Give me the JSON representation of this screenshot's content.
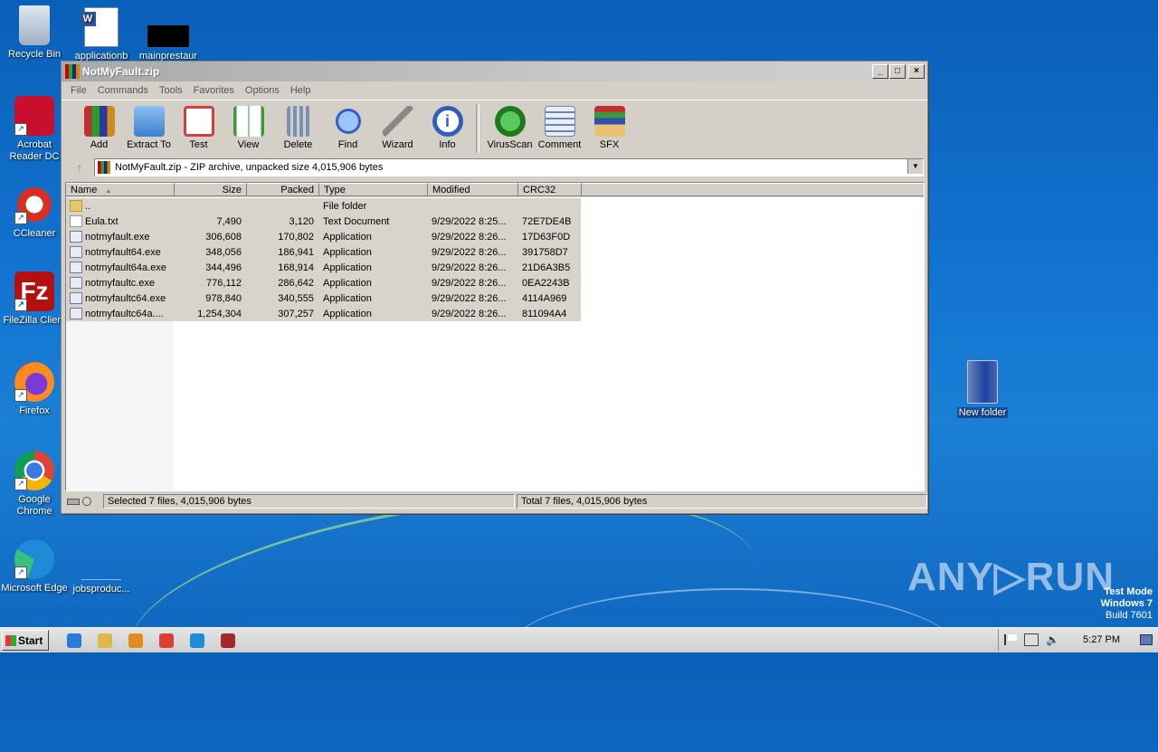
{
  "desktop": {
    "icons": [
      {
        "label": "Recycle Bin"
      },
      {
        "label": "applicationb"
      },
      {
        "label": "mainprestaur"
      },
      {
        "label": "Acrobat Reader DC"
      },
      {
        "label": "CCleaner"
      },
      {
        "label": "FileZilla Client"
      },
      {
        "label": "Firefox"
      },
      {
        "label": "Google Chrome"
      },
      {
        "label": "Microsoft Edge"
      },
      {
        "label": "jobsproduc..."
      },
      {
        "label": "New folder"
      }
    ]
  },
  "window": {
    "title": "NotMyFault.zip",
    "controls": {
      "minimize": "_",
      "maximize": "□",
      "close": "×"
    },
    "menu": [
      "File",
      "Commands",
      "Tools",
      "Favorites",
      "Options",
      "Help"
    ],
    "toolbar": {
      "left": [
        {
          "label": "Add",
          "icon": "add-icon",
          "color": "#c03030"
        },
        {
          "label": "Extract To",
          "icon": "folder-extract-icon",
          "color": "#3b7fd0"
        },
        {
          "label": "Test",
          "icon": "test-clipboard-icon",
          "color": "#d04040"
        },
        {
          "label": "View",
          "icon": "book-view-icon",
          "color": "#3a9a3a"
        },
        {
          "label": "Delete",
          "icon": "trash-icon",
          "color": "#8090a8"
        },
        {
          "label": "Find",
          "icon": "magnifier-icon",
          "color": "#3060c0"
        },
        {
          "label": "Wizard",
          "icon": "magic-wand-icon",
          "color": "#b0b0b0"
        },
        {
          "label": "Info",
          "icon": "info-icon",
          "color": "#2f5fb8"
        }
      ],
      "right": [
        {
          "label": "VirusScan",
          "icon": "virus-scan-icon",
          "color": "#2f9a2f"
        },
        {
          "label": "Comment",
          "icon": "comment-icon",
          "color": "#6c86b0"
        },
        {
          "label": "SFX",
          "icon": "sfx-box-icon",
          "color": "#c87a30"
        }
      ]
    },
    "up_glyph": "↑",
    "address": "NotMyFault.zip - ZIP archive, unpacked size 4,015,906 bytes",
    "columns": [
      "Name",
      "Size",
      "Packed",
      "Type",
      "Modified",
      "CRC32"
    ],
    "sort_glyph": "▲",
    "files": [
      {
        "name": "..",
        "size": "",
        "packed": "",
        "type": "File folder",
        "modified": "",
        "crc": "",
        "kind": "folder"
      },
      {
        "name": "Eula.txt",
        "size": "7,490",
        "packed": "3,120",
        "type": "Text Document",
        "modified": "9/29/2022 8:25...",
        "crc": "72E7DE4B",
        "kind": "txt"
      },
      {
        "name": "notmyfault.exe",
        "size": "306,608",
        "packed": "170,802",
        "type": "Application",
        "modified": "9/29/2022 8:26...",
        "crc": "17D63F0D",
        "kind": "exe"
      },
      {
        "name": "notmyfault64.exe",
        "size": "348,056",
        "packed": "186,941",
        "type": "Application",
        "modified": "9/29/2022 8:26...",
        "crc": "391758D7",
        "kind": "exe"
      },
      {
        "name": "notmyfault64a.exe",
        "size": "344,496",
        "packed": "168,914",
        "type": "Application",
        "modified": "9/29/2022 8:26...",
        "crc": "21D6A3B5",
        "kind": "exe"
      },
      {
        "name": "notmyfaultc.exe",
        "size": "776,112",
        "packed": "286,642",
        "type": "Application",
        "modified": "9/29/2022 8:26...",
        "crc": "0EA2243B",
        "kind": "exe"
      },
      {
        "name": "notmyfaultc64.exe",
        "size": "978,840",
        "packed": "340,555",
        "type": "Application",
        "modified": "9/29/2022 8:26...",
        "crc": "4114A969",
        "kind": "exe"
      },
      {
        "name": "notmyfaultc64a....",
        "size": "1,254,304",
        "packed": "307,257",
        "type": "Application",
        "modified": "9/29/2022 8:26...",
        "crc": "811094A4",
        "kind": "exe"
      }
    ],
    "status_left": "Selected 7 files, 4,015,906 bytes",
    "status_right": "Total 7 files, 4,015,906 bytes"
  },
  "taskbar": {
    "start_label": "Start",
    "apps": [
      {
        "icon": "internet-explorer-icon",
        "color": "#2a7ad8"
      },
      {
        "icon": "file-explorer-icon",
        "color": "#e0b848"
      },
      {
        "icon": "media-player-icon",
        "color": "#e08a20"
      },
      {
        "icon": "chrome-icon",
        "color": "#d84030"
      },
      {
        "icon": "edge-icon",
        "color": "#1e8ad8"
      },
      {
        "icon": "winrar-icon",
        "color": "#a02828"
      }
    ],
    "clock": "5:27 PM"
  },
  "watermark": "ANY▷RUN",
  "test_mode": {
    "line1": "Test Mode",
    "line2": "Windows 7",
    "line3": "Build 7601"
  }
}
